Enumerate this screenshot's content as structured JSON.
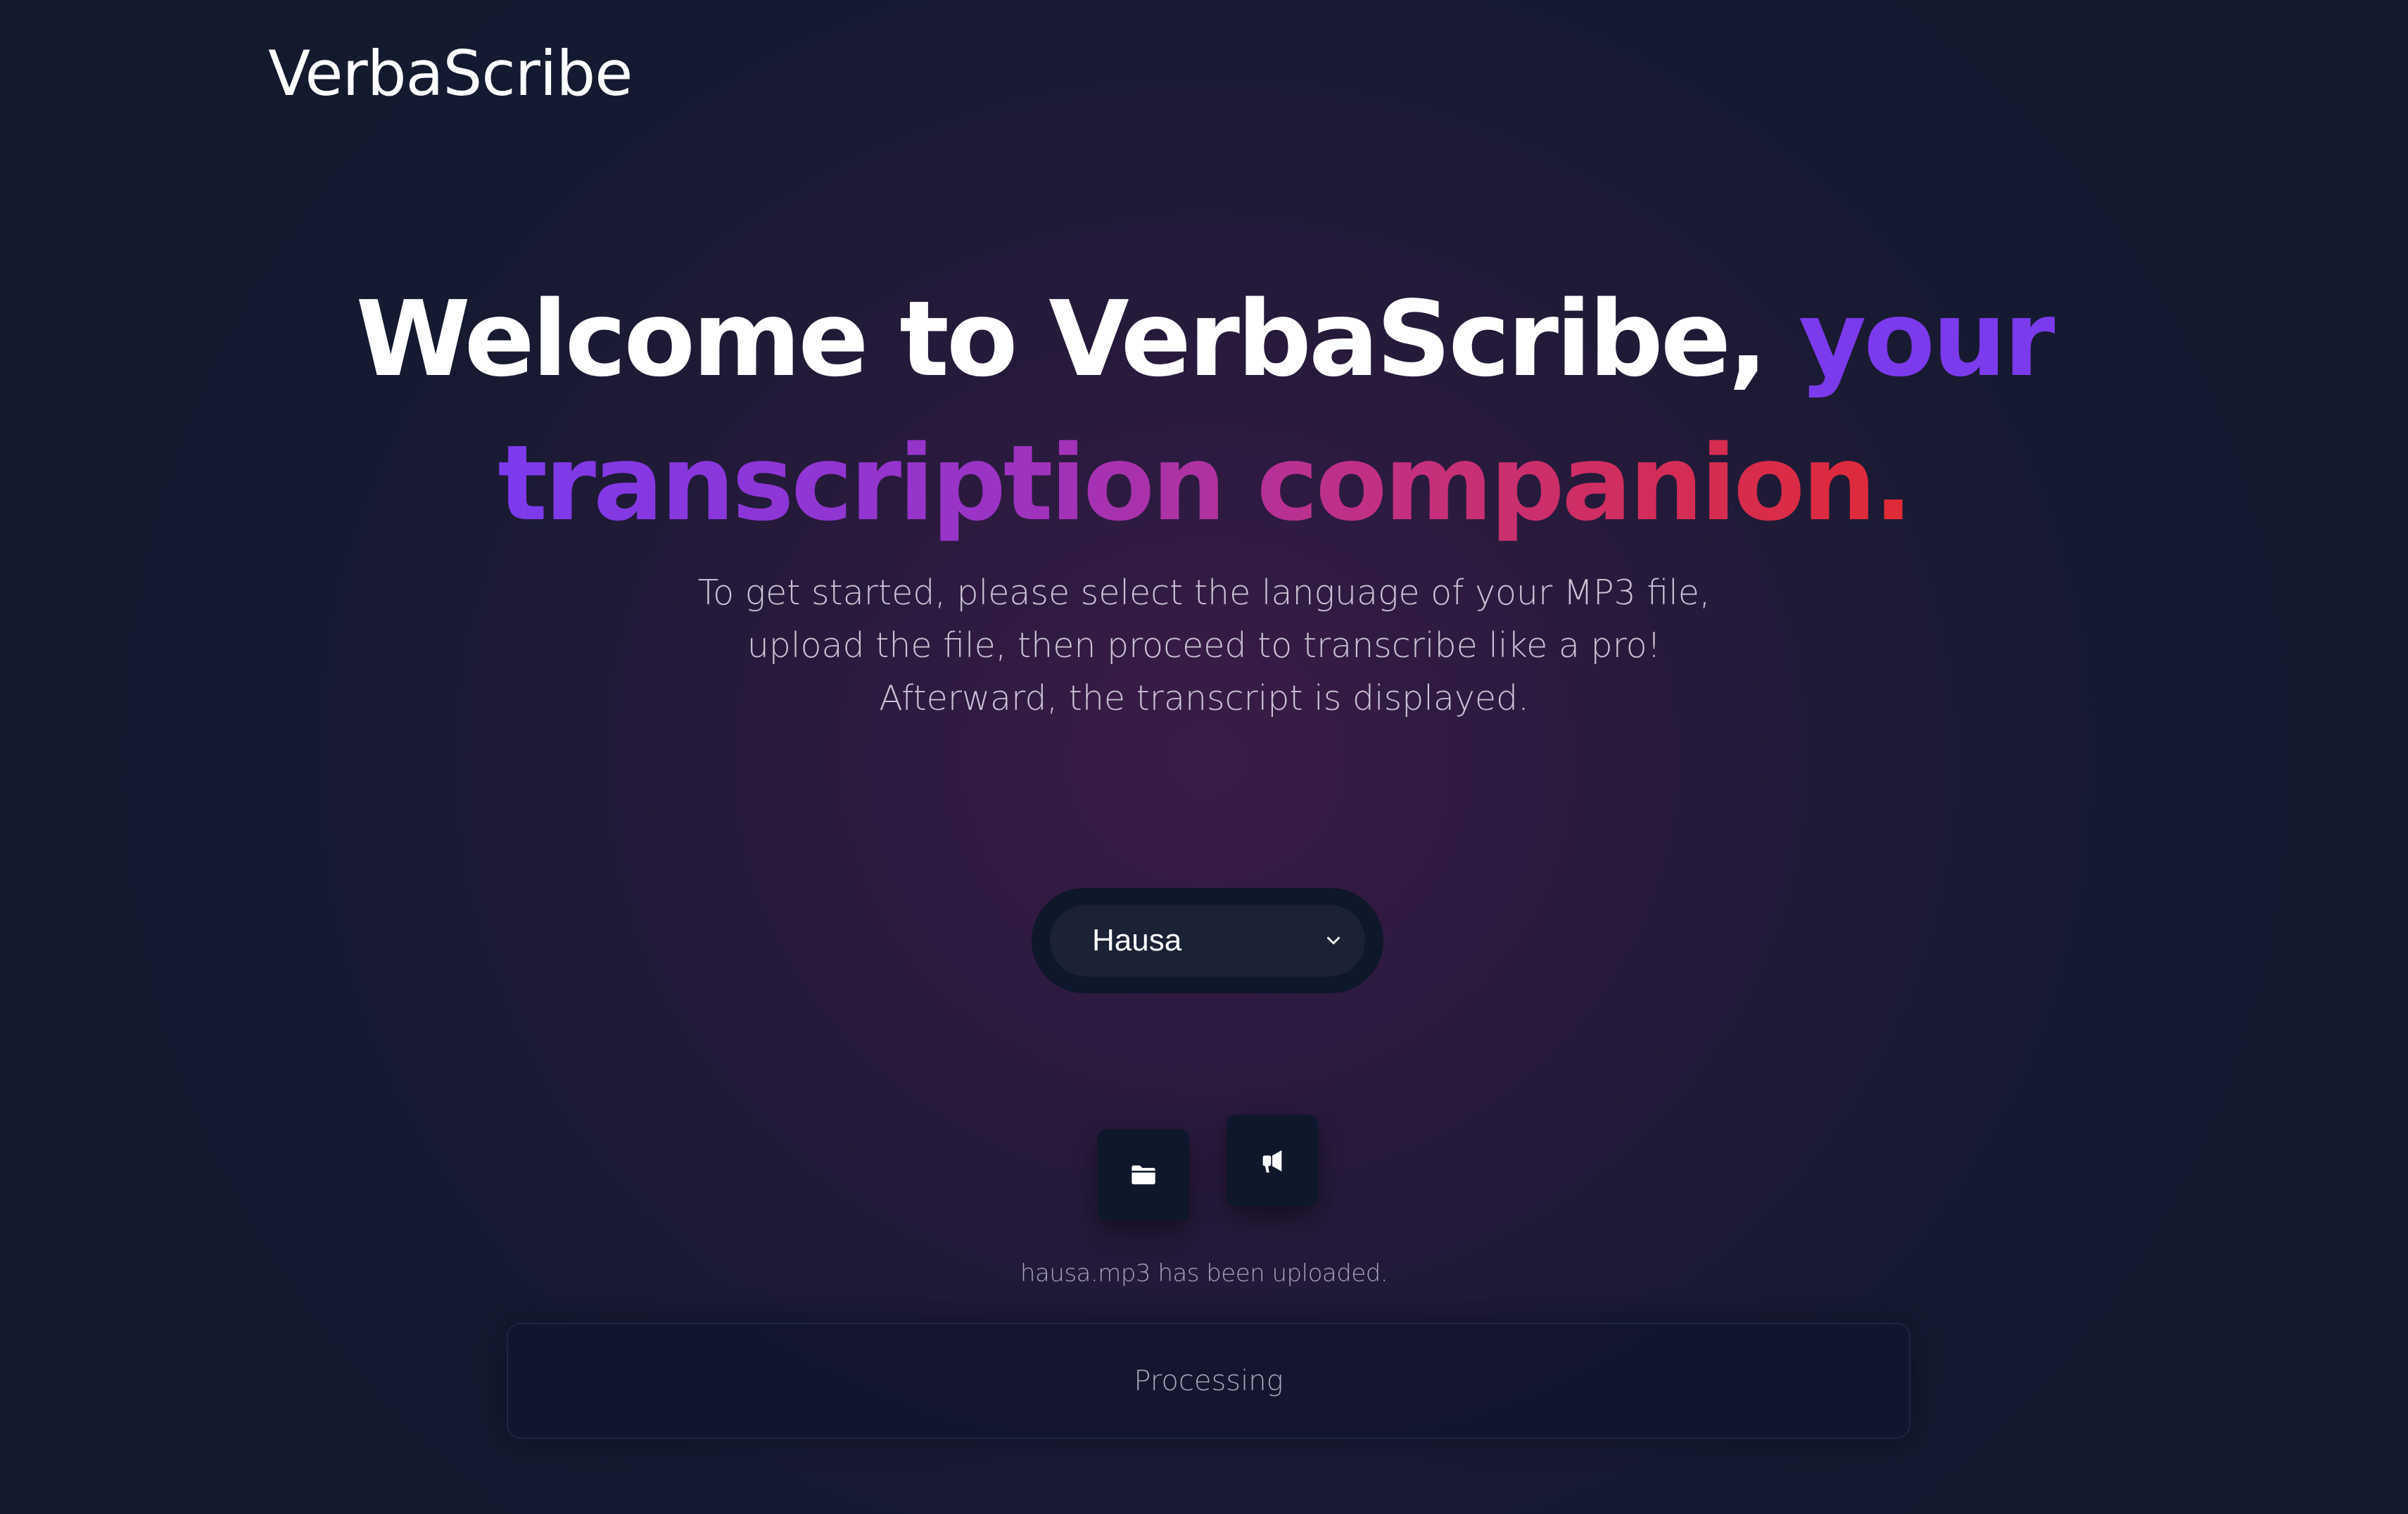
{
  "header": {
    "logo": "VerbaScribe"
  },
  "hero": {
    "headline_part1": "Welcome to VerbaScribe,",
    "headline_part2": "your",
    "headline_part3": "transcription companion.",
    "subtitle": "To get started, please select the language of your MP3 file, upload the file, then proceed to transcribe like a pro! Afterward, the transcript is displayed."
  },
  "language_select": {
    "selected": "Hausa",
    "icon": "chevron-down-icon"
  },
  "actions": {
    "upload_icon": "folder-icon",
    "transcribe_icon": "megaphone-icon"
  },
  "upload_status": "hausa.mp3 has been uploaded.",
  "processing": {
    "label": "Processing"
  },
  "colors": {
    "accent_purple": "#7c3aed",
    "accent_red": "#e02a35",
    "button_bg": "#0f172a"
  }
}
